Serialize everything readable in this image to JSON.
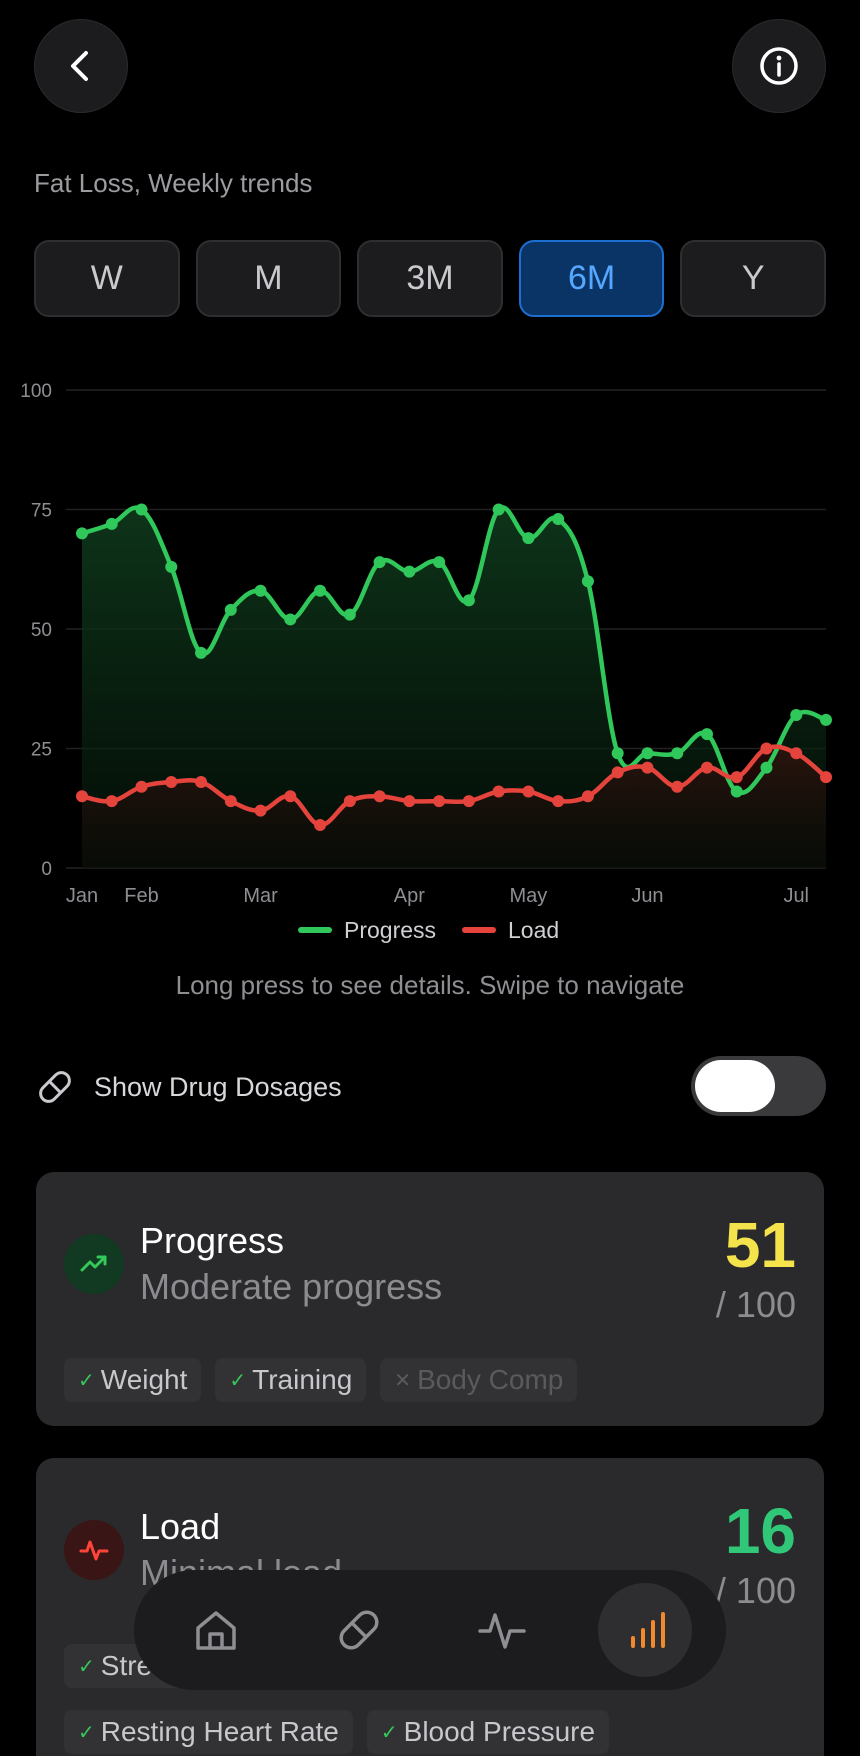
{
  "header": {
    "subtitle": "Fat Loss, Weekly trends"
  },
  "ranges": [
    {
      "label": "W",
      "active": false
    },
    {
      "label": "M",
      "active": false
    },
    {
      "label": "3M",
      "active": false
    },
    {
      "label": "6M",
      "active": true
    },
    {
      "label": "Y",
      "active": false
    }
  ],
  "chart_data": {
    "type": "area",
    "ylim": [
      0,
      100
    ],
    "yticks": [
      0,
      25,
      50,
      75,
      100
    ],
    "x_tick_labels": [
      "Jan",
      "Feb",
      "Mar",
      "Apr",
      "May",
      "Jun",
      "Jul"
    ],
    "x_tick_positions": [
      0,
      2,
      6,
      11,
      15,
      19,
      24
    ],
    "x": [
      "Jan",
      "",
      "Feb",
      "",
      "",
      "",
      "Mar",
      "",
      "",
      "",
      "",
      "Apr",
      "",
      "",
      "",
      "May",
      "",
      "",
      "",
      "Jun",
      "",
      "",
      "",
      "",
      "Jul",
      ""
    ],
    "grid": true,
    "legend": "bottom",
    "series": [
      {
        "name": "Progress",
        "color": "#30c85a",
        "values": [
          70,
          72,
          75,
          63,
          45,
          54,
          58,
          52,
          58,
          53,
          64,
          62,
          64,
          56,
          75,
          69,
          73,
          60,
          24,
          24,
          24,
          28,
          16,
          21,
          32,
          31
        ]
      },
      {
        "name": "Load",
        "color": "#e5443d",
        "values": [
          15,
          14,
          17,
          18,
          18,
          14,
          12,
          15,
          9,
          14,
          15,
          14,
          14,
          14,
          16,
          16,
          14,
          15,
          20,
          21,
          17,
          21,
          19,
          25,
          24,
          19
        ]
      }
    ]
  },
  "hint": "Long press to see details. Swipe to navigate",
  "toggle": {
    "label": "Show Drug Dosages",
    "on": true
  },
  "cards": {
    "progress": {
      "title": "Progress",
      "subtitle": "Moderate progress",
      "score": "51",
      "denominator": "/ 100",
      "score_color": "#f4e34b",
      "tags": [
        {
          "label": "Weight",
          "mark": "✓",
          "enabled": true
        },
        {
          "label": "Training",
          "mark": "✓",
          "enabled": true
        },
        {
          "label": "Body Comp",
          "mark": "✕",
          "enabled": false
        }
      ]
    },
    "load": {
      "title": "Load",
      "subtitle": "Minimal load",
      "score": "16",
      "denominator": "/ 100",
      "score_color": "#30c878",
      "tags": [
        {
          "label": "Stress",
          "mark": "✓",
          "enabled": true
        },
        {
          "label": "Resting Heart Rate",
          "mark": "✓",
          "enabled": true
        },
        {
          "label": "Blood Pressure",
          "mark": "✓",
          "enabled": true
        }
      ]
    }
  },
  "nav": {
    "items": [
      "home-icon",
      "pill-icon",
      "activity-icon",
      "chart-icon"
    ],
    "active": "chart-icon",
    "active_color": "#f08a2c"
  }
}
